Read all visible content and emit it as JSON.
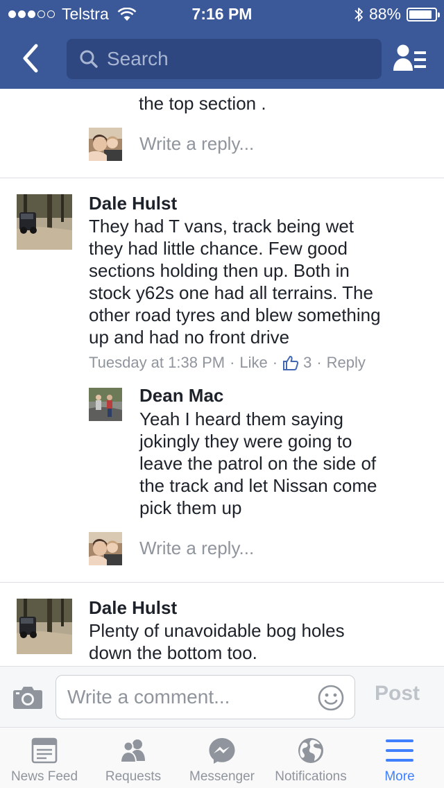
{
  "status_bar": {
    "carrier": "Telstra",
    "time": "7:16 PM",
    "battery": "88%",
    "battery_level": 0.88,
    "signal_bars": 3,
    "signal_total": 5
  },
  "nav": {
    "search_placeholder": "Search",
    "back_icon": "chevron-left-icon",
    "friends_icon": "friend-list-icon"
  },
  "feed": {
    "top_partial": {
      "text": "the top section ."
    },
    "reply_placeholder": "Write a reply...",
    "comments": [
      {
        "author": "Dale Hulst",
        "lines": [
          "They had T vans,  track being wet",
          "they had little chance. Few good",
          "sections holding then up. Both in",
          "stock y62s one had all terrains. The",
          "other road tyres and blew something",
          "up and had no front drive"
        ],
        "time": "Tuesday at 1:38 PM",
        "like_label": "Like",
        "like_count": "3",
        "reply_label": "Reply",
        "replies": [
          {
            "author": "Dean Mac",
            "lines": [
              "Yeah I heard them saying",
              "jokingly they were going to",
              "leave the patrol on the side of",
              "the track and let Nissan come",
              "pick them up"
            ]
          }
        ]
      },
      {
        "author": "Dale Hulst",
        "lines": [
          "Plenty of unavoidable bog holes",
          "down the bottom too."
        ]
      }
    ]
  },
  "composer": {
    "placeholder": "Write a comment...",
    "post_label": "Post"
  },
  "tabs": [
    {
      "label": "News Feed",
      "icon": "news-feed-icon",
      "active": false
    },
    {
      "label": "Requests",
      "icon": "friend-requests-icon",
      "active": false
    },
    {
      "label": "Messenger",
      "icon": "messenger-icon",
      "active": false
    },
    {
      "label": "Notifications",
      "icon": "globe-icon",
      "active": false
    },
    {
      "label": "More",
      "icon": "hamburger-menu-icon",
      "active": true
    }
  ],
  "colors": {
    "brand_blue": "#3b5998",
    "search_bg": "#2e4780",
    "meta_gray": "#90949c",
    "active_tab": "#4080ff"
  }
}
